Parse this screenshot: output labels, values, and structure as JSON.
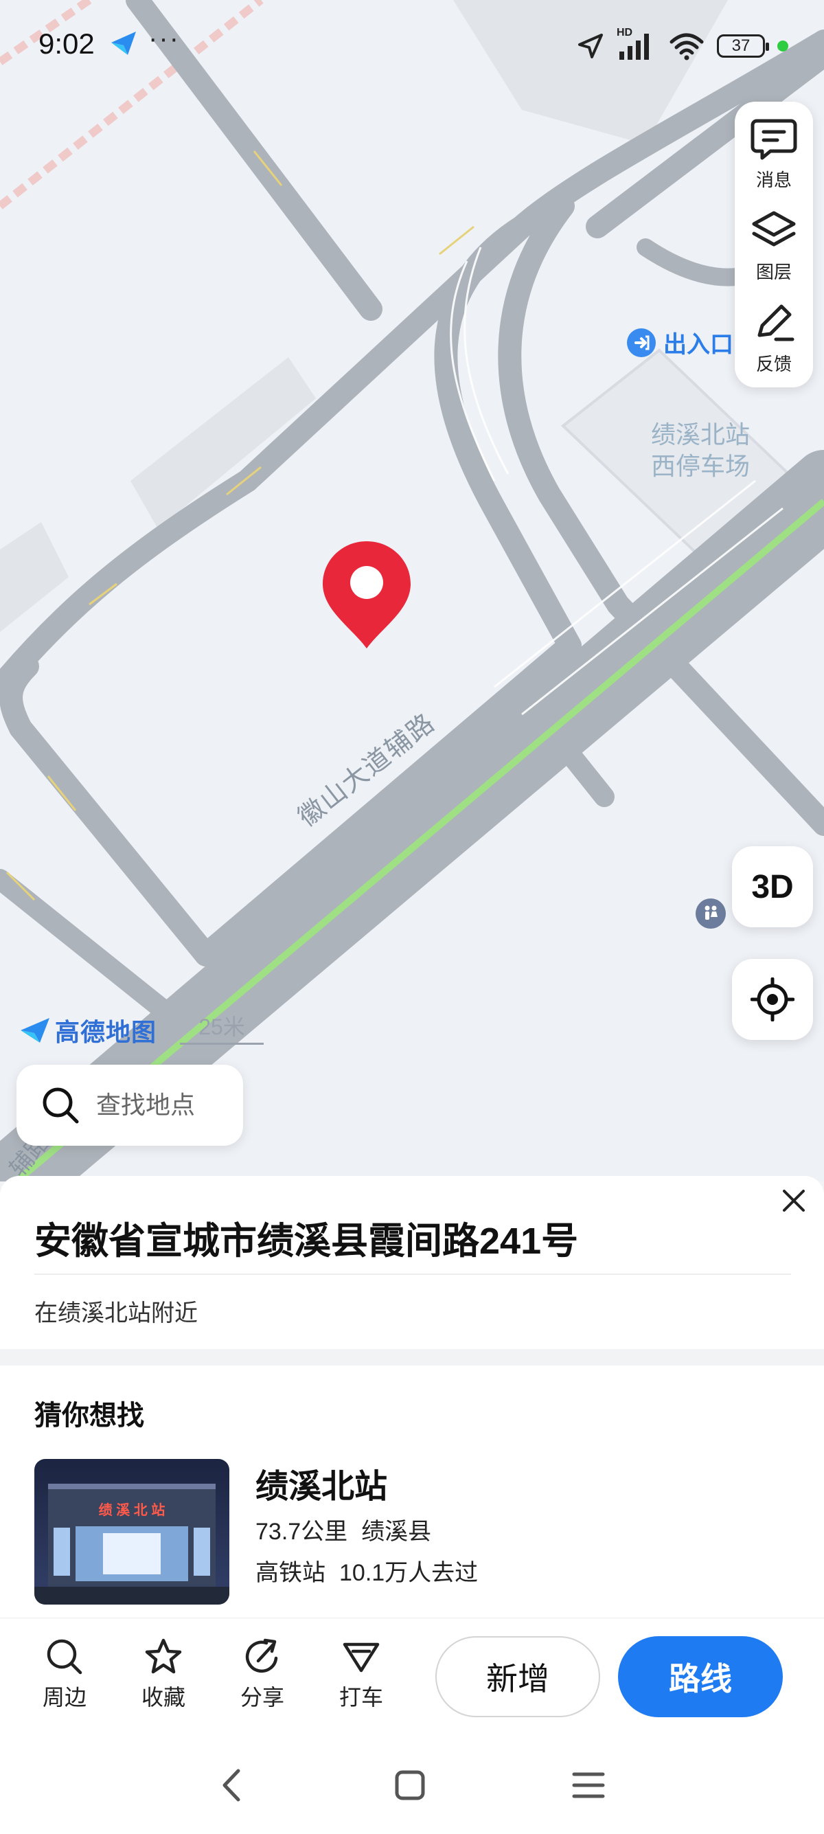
{
  "status_bar": {
    "time": "9:02",
    "more": "···",
    "network": "HD",
    "battery": "37",
    "icons": [
      "location-arrow-icon",
      "signal-icon",
      "wifi-icon",
      "battery-icon"
    ]
  },
  "map": {
    "tools": [
      {
        "label": "消息",
        "icon": "message-icon"
      },
      {
        "label": "图层",
        "icon": "layers-icon"
      },
      {
        "label": "反馈",
        "icon": "feedback-edit-icon"
      }
    ],
    "btn_3d": "3D",
    "entrance_label": "出入口",
    "parking_label": "绩溪北站\n西停车场",
    "road_label": "徽山大道辅路",
    "road_label_partial": "辅路",
    "brand": "高德地图",
    "scale": "25米",
    "search_placeholder": "查找地点"
  },
  "address_card": {
    "title": "安徽省宣城市绩溪县霞间路241号",
    "subtitle": "在绩溪北站附近"
  },
  "guess": {
    "title": "猜你想找",
    "thumb_sign": "绩 溪 北 站",
    "name": "绩溪北站",
    "distance": "73.7公里",
    "region": "绩溪县",
    "type": "高铁站",
    "visits": "10.1万人去过"
  },
  "actions": {
    "nearby": "周边",
    "favorite": "收藏",
    "share": "分享",
    "taxi": "打车",
    "add": "新增",
    "route": "路线"
  },
  "colors": {
    "accent": "#1f7bf2",
    "pin": "#e8283a",
    "road": "#adb3ba",
    "rail": "#9fe085"
  }
}
